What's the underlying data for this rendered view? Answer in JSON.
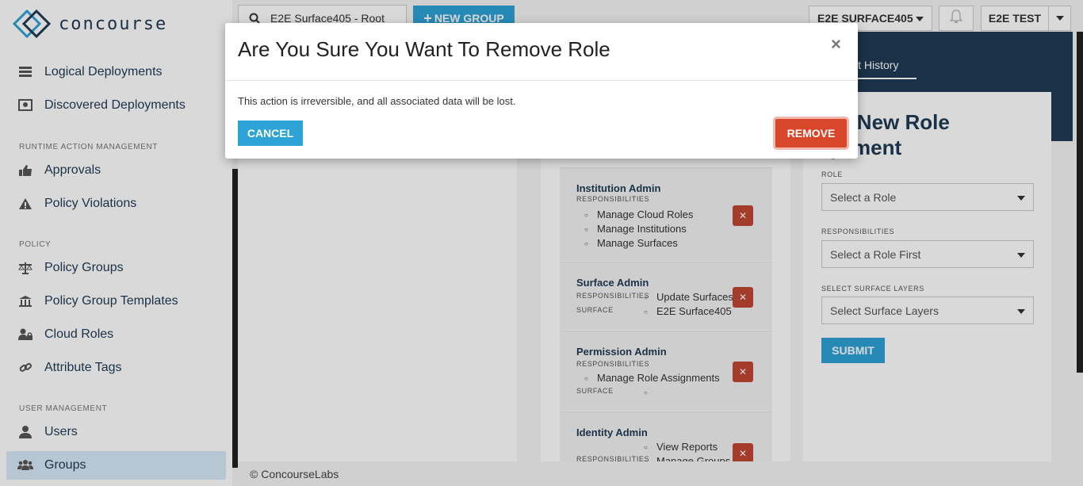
{
  "app": {
    "logo_text": "concourse"
  },
  "sidebar": {
    "items": [
      {
        "label": "Logical Deployments",
        "icon": "server-stack-icon"
      },
      {
        "label": "Discovered Deployments",
        "icon": "discover-icon"
      },
      {
        "label": "Approvals",
        "icon": "thumbs-up-icon"
      },
      {
        "label": "Policy Violations",
        "icon": "warning-icon"
      },
      {
        "label": "Policy Groups",
        "icon": "balance-scale-icon"
      },
      {
        "label": "Policy Group Templates",
        "icon": "institution-icon"
      },
      {
        "label": "Cloud Roles",
        "icon": "user-lock-icon"
      },
      {
        "label": "Attribute Tags",
        "icon": "link-icon"
      },
      {
        "label": "Users",
        "icon": "user-icon"
      },
      {
        "label": "Groups",
        "icon": "users-icon",
        "active": true
      }
    ],
    "sections": {
      "runtime": "RUNTIME ACTION MANAGEMENT",
      "policy": "POLICY",
      "user_mgmt": "USER MANAGEMENT"
    }
  },
  "topbar": {
    "search_value": "E2E Surface405 - Root",
    "new_group_label": "NEW GROUP",
    "surface_select": "E2E SURFACE405",
    "user_label": "E2E TEST"
  },
  "roles": [
    {
      "title": "Institution Admin",
      "responsibilities_label": "RESPONSIBILITIES",
      "responsibilities": [
        "Manage Cloud Roles",
        "Manage Institutions",
        "Manage Surfaces"
      ]
    },
    {
      "title": "Surface Admin",
      "responsibilities_label": "RESPONSIBILITIES",
      "responsibilities": [
        "Update Surfaces"
      ],
      "surface_label": "SURFACE",
      "surfaces": [
        "E2E Surface405"
      ]
    },
    {
      "title": "Permission Admin",
      "responsibilities_label": "RESPONSIBILITIES",
      "responsibilities": [
        "Manage Role Assignments"
      ],
      "surface_label": "SURFACE",
      "surfaces": [
        ""
      ]
    },
    {
      "title": "Identity Admin",
      "responsibilities_label": "RESPONSIBILITIES",
      "responsibilities": [
        "View Reports",
        "Manage Groups"
      ]
    }
  ],
  "right_panel": {
    "history_tab": "it History",
    "form_title": "ate New Role ignment",
    "role_label": "ROLE",
    "role_placeholder": "Select a Role",
    "responsibilities_label": "RESPONSIBILITIES",
    "responsibilities_placeholder": "Select a Role First",
    "surface_layers_label": "SELECT SURFACE LAYERS",
    "surface_layers_placeholder": "Select Surface Layers",
    "submit_label": "SUBMIT"
  },
  "footer": {
    "text": "© ConcourseLabs"
  },
  "modal": {
    "title": "Are You Sure You Want To Remove Role",
    "close": "×",
    "body": "This action is irreversible, and all associated data will be lost.",
    "cancel_label": "CANCEL",
    "remove_label": "REMOVE"
  },
  "colors": {
    "brand_dark": "#1f3a54",
    "primary": "#2ea3d6",
    "danger": "#d9472b",
    "active_nav": "#d6e9f8"
  }
}
